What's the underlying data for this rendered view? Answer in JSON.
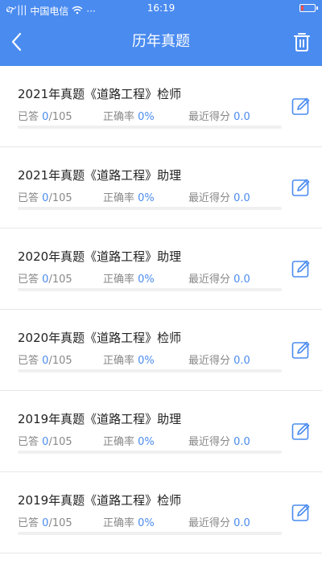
{
  "statusbar": {
    "signal_text": "🙰|||",
    "carrier": "中国电信",
    "dots": "···",
    "time": "16:19"
  },
  "navbar": {
    "title": "历年真题"
  },
  "colors": {
    "primary": "#4a8bf0",
    "text": "#222222",
    "muted": "#888888"
  },
  "exams": [
    {
      "title": "2021年真题《道路工程》检师",
      "answered_label": "已答",
      "answered": "0",
      "total": "/105",
      "accuracy_label": "正确率",
      "accuracy": "0%",
      "score_label": "最近得分",
      "score": "0.0",
      "progress": 0
    },
    {
      "title": "2021年真题《道路工程》助理",
      "answered_label": "已答",
      "answered": "0",
      "total": "/105",
      "accuracy_label": "正确率",
      "accuracy": "0%",
      "score_label": "最近得分",
      "score": "0.0",
      "progress": 0
    },
    {
      "title": "2020年真题《道路工程》助理",
      "answered_label": "已答",
      "answered": "0",
      "total": "/105",
      "accuracy_label": "正确率",
      "accuracy": "0%",
      "score_label": "最近得分",
      "score": "0.0",
      "progress": 0
    },
    {
      "title": "2020年真题《道路工程》检师",
      "answered_label": "已答",
      "answered": "0",
      "total": "/105",
      "accuracy_label": "正确率",
      "accuracy": "0%",
      "score_label": "最近得分",
      "score": "0.0",
      "progress": 0
    },
    {
      "title": "2019年真题《道路工程》助理",
      "answered_label": "已答",
      "answered": "0",
      "total": "/105",
      "accuracy_label": "正确率",
      "accuracy": "0%",
      "score_label": "最近得分",
      "score": "0.0",
      "progress": 0
    },
    {
      "title": "2019年真题《道路工程》检师",
      "answered_label": "已答",
      "answered": "0",
      "total": "/105",
      "accuracy_label": "正确率",
      "accuracy": "0%",
      "score_label": "最近得分",
      "score": "0.0",
      "progress": 0
    }
  ]
}
